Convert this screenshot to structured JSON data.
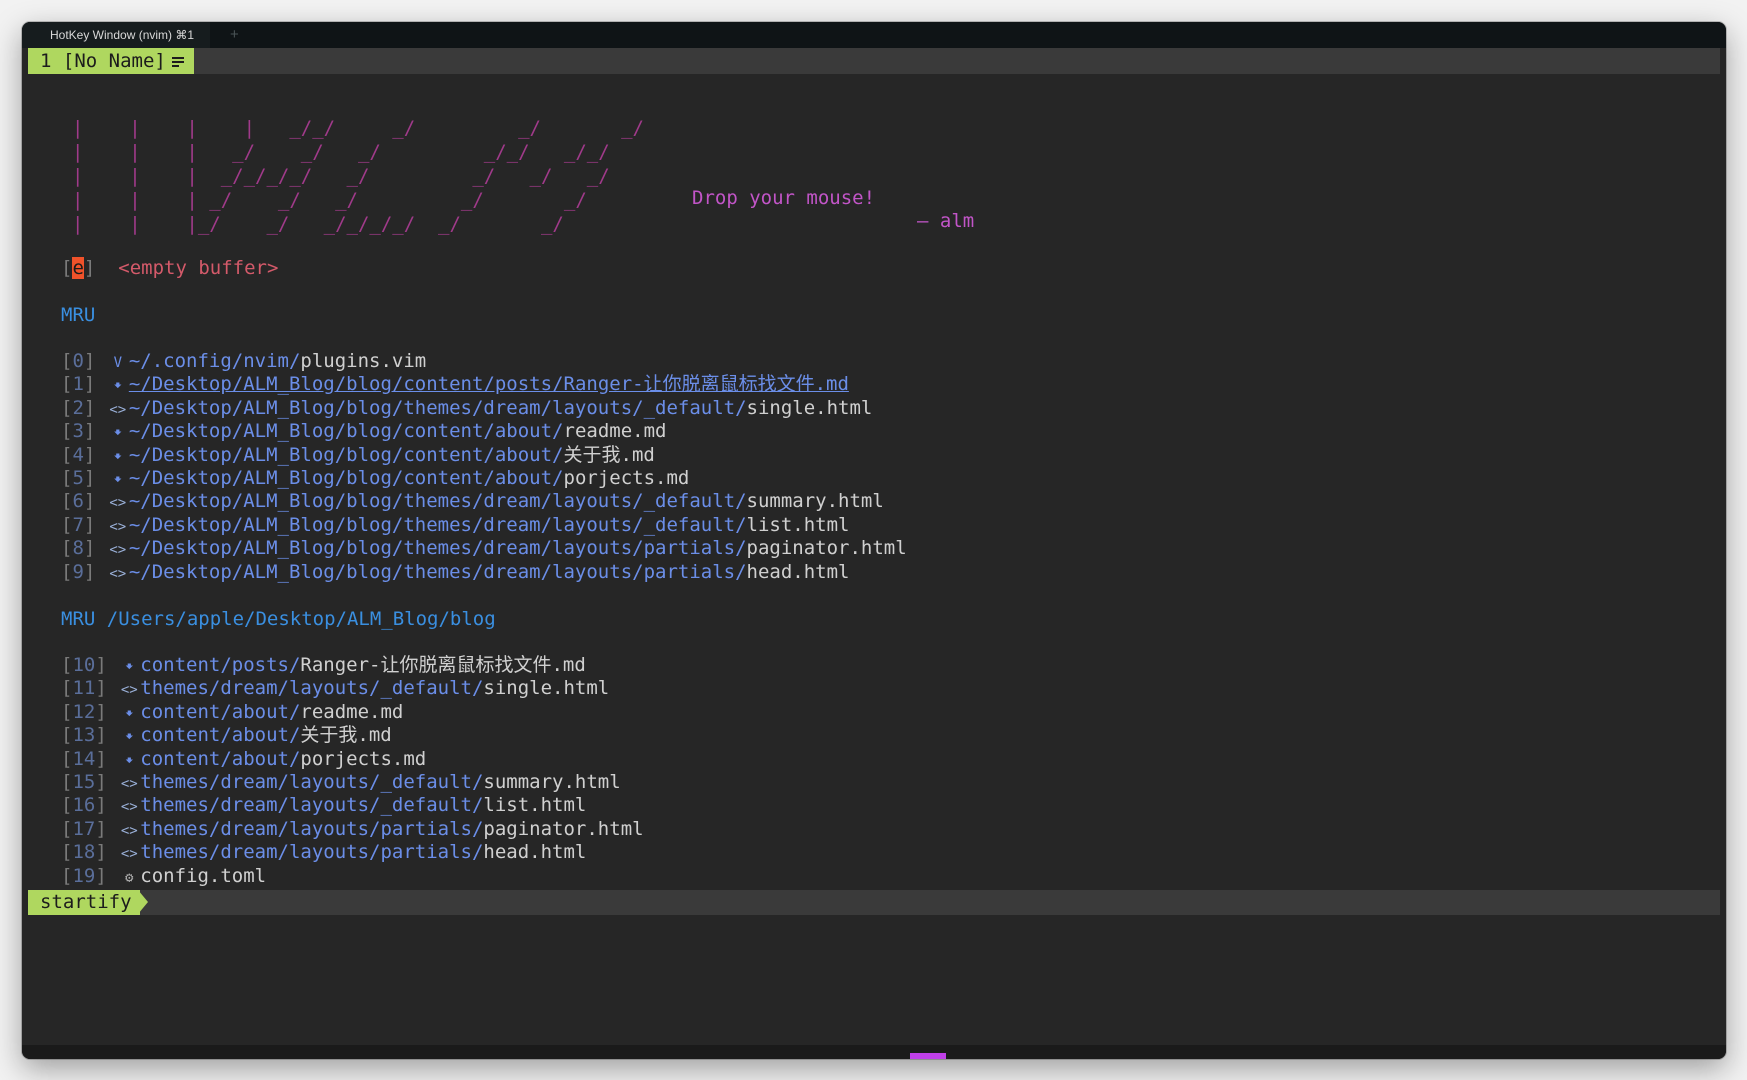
{
  "window": {
    "title": "HotKey Window (nvim)  ⌘1",
    "new_tab": "+"
  },
  "tabline": {
    "active_tab": "1 [No Name]",
    "list_icon": "list-icon"
  },
  "banner": {
    "logo_lines": [
      "|    |    |    |   _/_/     _/         _/       _/",
      "|    |    |   _/    _/   _/         _/_/   _/_/",
      "|    |    |  _/_/_/_/   _/         _/   _/   _/",
      "|    |    | _/    _/   _/         _/       _/",
      "|    |    |_/    _/   _/_/_/_/  _/       _/"
    ],
    "quote": "Drop your mouse!",
    "author": "— alm"
  },
  "empty_buffer": {
    "key": "e",
    "label": "<empty buffer>"
  },
  "mru_global": {
    "header": "MRU",
    "items": [
      {
        "index": "0",
        "icon": "vim-icon",
        "glyph": "V",
        "path": "~/.config/nvim/",
        "file": "plugins.vim",
        "highlight": false
      },
      {
        "index": "1",
        "icon": "markdown-icon",
        "glyph": "🠻",
        "path": "~/Desktop/ALM_Blog/blog/content/posts/",
        "file": "Ranger-让你脱离鼠标找文件.md",
        "highlight": true
      },
      {
        "index": "2",
        "icon": "html-icon",
        "glyph": "<>",
        "path": "~/Desktop/ALM_Blog/blog/themes/dream/layouts/_default/",
        "file": "single.html",
        "highlight": false
      },
      {
        "index": "3",
        "icon": "markdown-icon",
        "glyph": "🠻",
        "path": "~/Desktop/ALM_Blog/blog/content/about/",
        "file": "readme.md",
        "highlight": false
      },
      {
        "index": "4",
        "icon": "markdown-icon",
        "glyph": "🠻",
        "path": "~/Desktop/ALM_Blog/blog/content/about/",
        "file": "关于我.md",
        "highlight": false
      },
      {
        "index": "5",
        "icon": "markdown-icon",
        "glyph": "🠻",
        "path": "~/Desktop/ALM_Blog/blog/content/about/",
        "file": "porjects.md",
        "highlight": false
      },
      {
        "index": "6",
        "icon": "html-icon",
        "glyph": "<>",
        "path": "~/Desktop/ALM_Blog/blog/themes/dream/layouts/_default/",
        "file": "summary.html",
        "highlight": false
      },
      {
        "index": "7",
        "icon": "html-icon",
        "glyph": "<>",
        "path": "~/Desktop/ALM_Blog/blog/themes/dream/layouts/_default/",
        "file": "list.html",
        "highlight": false
      },
      {
        "index": "8",
        "icon": "html-icon",
        "glyph": "<>",
        "path": "~/Desktop/ALM_Blog/blog/themes/dream/layouts/partials/",
        "file": "paginator.html",
        "highlight": false
      },
      {
        "index": "9",
        "icon": "html-icon",
        "glyph": "<>",
        "path": "~/Desktop/ALM_Blog/blog/themes/dream/layouts/partials/",
        "file": "head.html",
        "highlight": false
      }
    ]
  },
  "mru_dir": {
    "header": "MRU /Users/apple/Desktop/ALM_Blog/blog",
    "items": [
      {
        "index": "10",
        "icon": "markdown-icon",
        "glyph": "🠻",
        "path": "content/posts/",
        "file": "Ranger-让你脱离鼠标找文件.md"
      },
      {
        "index": "11",
        "icon": "html-icon",
        "glyph": "<>",
        "path": "themes/dream/layouts/_default/",
        "file": "single.html"
      },
      {
        "index": "12",
        "icon": "markdown-icon",
        "glyph": "🠻",
        "path": "content/about/",
        "file": "readme.md"
      },
      {
        "index": "13",
        "icon": "markdown-icon",
        "glyph": "🠻",
        "path": "content/about/",
        "file": "关于我.md"
      },
      {
        "index": "14",
        "icon": "markdown-icon",
        "glyph": "🠻",
        "path": "content/about/",
        "file": "porjects.md"
      },
      {
        "index": "15",
        "icon": "html-icon",
        "glyph": "<>",
        "path": "themes/dream/layouts/_default/",
        "file": "summary.html"
      },
      {
        "index": "16",
        "icon": "html-icon",
        "glyph": "<>",
        "path": "themes/dream/layouts/_default/",
        "file": "list.html"
      },
      {
        "index": "17",
        "icon": "html-icon",
        "glyph": "<>",
        "path": "themes/dream/layouts/partials/",
        "file": "paginator.html"
      },
      {
        "index": "18",
        "icon": "html-icon",
        "glyph": "<>",
        "path": "themes/dream/layouts/partials/",
        "file": "head.html"
      },
      {
        "index": "19",
        "icon": "gear-icon",
        "glyph": "⚙",
        "path": "",
        "file": "config.toml"
      }
    ]
  },
  "statusline": {
    "mode": "startify"
  },
  "colors": {
    "accent_green": "#afd75f",
    "path_blue": "#6b8ee8",
    "header_blue": "#3a8fe0",
    "logo_magenta": "#a03a8a",
    "quote_purple": "#c255c8",
    "empty_red": "#d45a6a",
    "cursor_orange": "#f0522a",
    "background": "#262626"
  }
}
